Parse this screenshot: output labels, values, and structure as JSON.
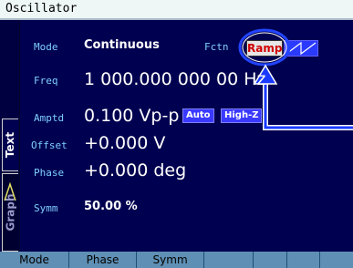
{
  "title": "Oscillator",
  "side_tabs": {
    "text": "Text",
    "graph": "Graph"
  },
  "params": {
    "mode": {
      "label": "Mode",
      "value": "Continuous"
    },
    "fctn": {
      "label": "Fctn",
      "value": "Ramp"
    },
    "freq": {
      "label": "Freq",
      "value": "1 000.000 000 00 Hz"
    },
    "amptd": {
      "label": "Amptd",
      "value": "0.100 Vp-p",
      "chips": [
        "Auto",
        "High-Z"
      ]
    },
    "offset": {
      "label": "Offset",
      "value": "+0.000 V"
    },
    "phase": {
      "label": "Phase",
      "value": "+0.000 deg"
    },
    "symm": {
      "label": "Symm",
      "value": "50.00 %"
    }
  },
  "softkeys": [
    "Mode",
    "Phase",
    "Symm",
    "",
    "",
    "",
    ""
  ],
  "colors": {
    "background": "#000050",
    "label": "#7fd0ff",
    "highlight_ring": "#2244ff",
    "ramp_text": "#d00000",
    "softkey_bar": "#5f8fb4"
  },
  "icons": [
    "ramp-wave-icon",
    "highlight-ring",
    "pointer-arrow-icon",
    "graph-wave-icon"
  ]
}
